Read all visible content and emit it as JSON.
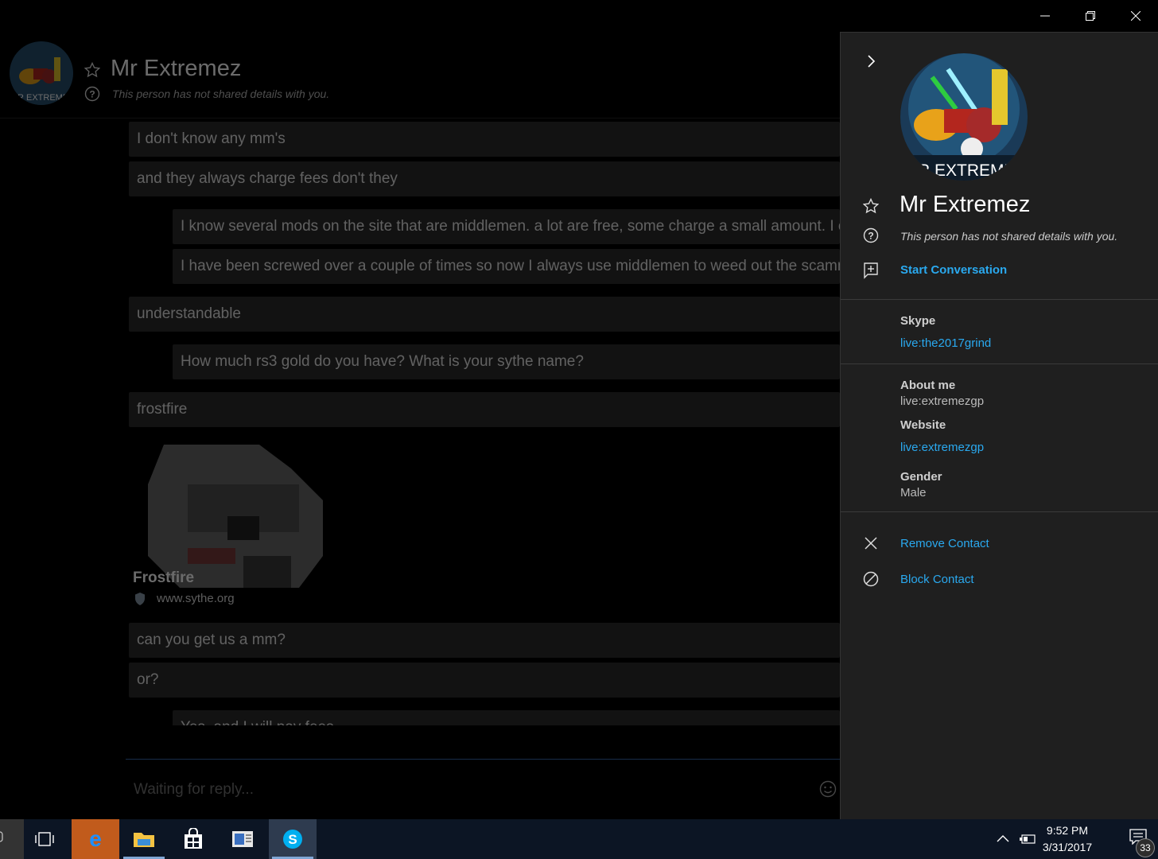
{
  "window": {
    "minimize_icon": "minimize-icon",
    "restore_icon": "restore-icon",
    "close_icon": "close-icon"
  },
  "chat": {
    "contact_name": "Mr Extremez",
    "contact_status": "This person has not shared details with you.",
    "messages": [
      {
        "direction": "in",
        "text": "I don't know any mm's"
      },
      {
        "direction": "in",
        "text": "and they always charge fees don't they"
      },
      {
        "direction": "out",
        "text": "I know several mods on the site that are middlemen. a lot are free, some charge a small amount. I co"
      },
      {
        "direction": "out",
        "text": "I have been screwed over a couple of times so now I always use middlemen to weed out the scamme"
      },
      {
        "direction": "in",
        "text": "understandable"
      },
      {
        "direction": "out",
        "text": "How much rs3 gold do you have? What is your sythe name?"
      },
      {
        "direction": "in",
        "text": "frostfire"
      },
      {
        "direction": "in",
        "text": "can you get us a mm?"
      },
      {
        "direction": "in",
        "text": "or?"
      },
      {
        "direction": "out",
        "text": "Yes, and I will pay fees"
      }
    ],
    "link_preview": {
      "title": "Frostfire",
      "url": "www.sythe.org"
    },
    "composer_placeholder": "Waiting for reply..."
  },
  "profile": {
    "name": "Mr Extremez",
    "status": "This person has not shared details with you.",
    "start_conversation": "Start Conversation",
    "skype_label": "Skype",
    "skype_id": "live:the2017grind",
    "about_label": "About me",
    "about_value": "live:extremezgp",
    "website_label": "Website",
    "website_value": "live:extremezgp",
    "gender_label": "Gender",
    "gender_value": "Male",
    "remove_contact": "Remove Contact",
    "block_contact": "Block Contact",
    "avatar_text": "R EXTREME"
  },
  "taskbar": {
    "time": "9:52 PM",
    "date": "3/31/2017",
    "notification_count": "33",
    "apps": [
      "task-view",
      "edge",
      "file-explorer",
      "store",
      "news",
      "skype"
    ]
  },
  "colors": {
    "accent": "#2aa9ef",
    "panel_bg": "#1f1f1f",
    "bubble_bg": "#2b2b2b"
  }
}
